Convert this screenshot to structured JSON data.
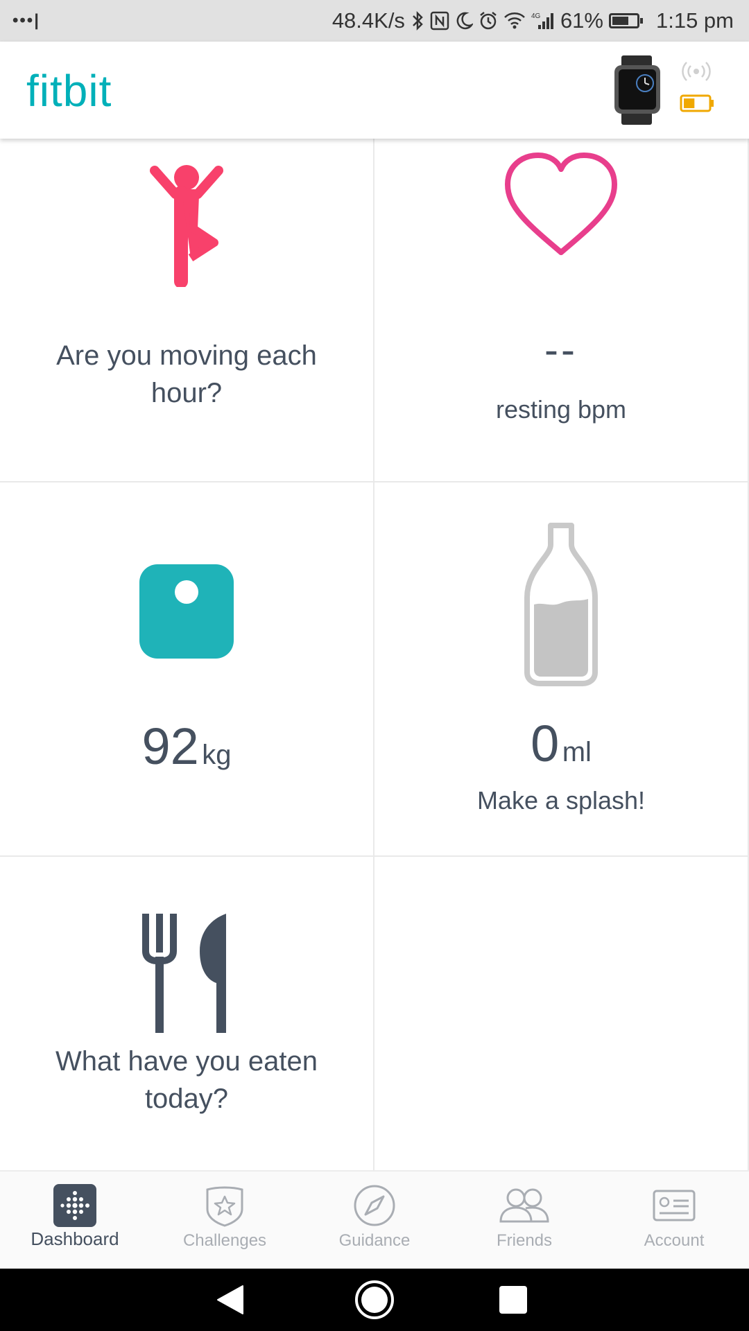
{
  "status_bar": {
    "left_dots": "•••|",
    "speed": "48.4K/s",
    "battery_percent": "61%",
    "time": "1:15 pm",
    "icons": [
      "bluetooth-icon",
      "nfc-icon",
      "do-not-disturb-icon",
      "alarm-icon",
      "wifi-icon",
      "signal-4g-icon",
      "battery-icon"
    ]
  },
  "header": {
    "logo": "fitbit",
    "device_battery_level": 0.45,
    "accent_color": "#00b0b9"
  },
  "tiles": {
    "hourly_activity": {
      "text": "Are you moving each hour?",
      "color": "#f8416b"
    },
    "heart_rate": {
      "value": "--",
      "label": "resting bpm",
      "color": "#e83e8c"
    },
    "weight": {
      "value": "92",
      "unit": "kg",
      "color": "#1fb3b8"
    },
    "water": {
      "value": "0",
      "unit": "ml",
      "label": "Make a splash!"
    },
    "food": {
      "text": "What have you eaten today?"
    }
  },
  "bottom_nav": [
    {
      "label": "Dashboard",
      "icon": "dashboard-icon",
      "active": true
    },
    {
      "label": "Challenges",
      "icon": "challenges-icon",
      "active": false
    },
    {
      "label": "Guidance",
      "icon": "compass-icon",
      "active": false
    },
    {
      "label": "Friends",
      "icon": "friends-icon",
      "active": false
    },
    {
      "label": "Account",
      "icon": "account-card-icon",
      "active": false
    }
  ],
  "system_nav": [
    "back-icon",
    "home-icon",
    "recents-icon"
  ]
}
